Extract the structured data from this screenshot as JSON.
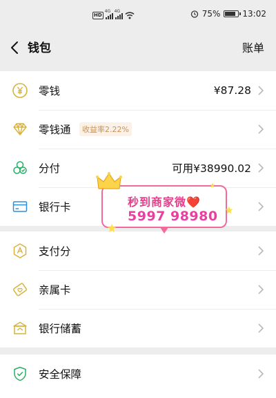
{
  "status_bar": {
    "hd_label": "HD",
    "network_label": "4G",
    "battery_text": "75%",
    "time": "13:02"
  },
  "header": {
    "title": "钱包",
    "right_action": "账单"
  },
  "items": {
    "change": {
      "label": "零钱",
      "value": "¥87.28",
      "icon": "yen-coin-icon"
    },
    "licaitong": {
      "label": "零钱通",
      "badge": "收益率2.22%",
      "icon": "diamond-icon"
    },
    "fenfu": {
      "label": "分付",
      "value": "可用¥38990.02",
      "icon": "fenfu-icon"
    },
    "bank_card": {
      "label": "银行卡",
      "icon": "bank-card-icon"
    },
    "pay_score": {
      "label": "支付分",
      "icon": "pay-score-icon"
    },
    "family_card": {
      "label": "亲属卡",
      "icon": "family-card-icon"
    },
    "savings": {
      "label": "银行储蓄",
      "icon": "savings-icon"
    },
    "security": {
      "label": "安全保障",
      "icon": "shield-icon"
    }
  },
  "promo": {
    "line1": "秒到商家微❤️",
    "line2": "5997 98980"
  },
  "colors": {
    "accent_gold": "#d8b23a",
    "green": "#2aae67",
    "promo_pink": "#f06a9c",
    "badge_text": "#c7935a"
  }
}
